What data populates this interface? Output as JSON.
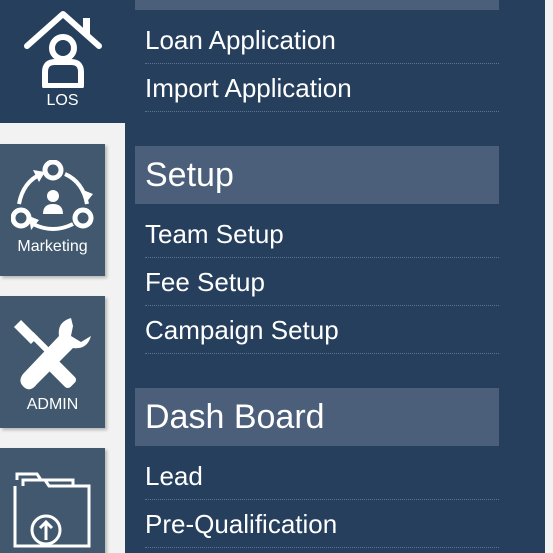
{
  "rail": {
    "items": [
      {
        "label": "LOS",
        "icon": "house-user-icon"
      },
      {
        "label": "Marketing",
        "icon": "people-cycle-icon"
      },
      {
        "label": "ADMIN",
        "icon": "tools-icon"
      },
      {
        "label": "",
        "icon": "folder-upload-icon"
      }
    ]
  },
  "menu": {
    "los_items": [
      {
        "label": "Loan Application"
      },
      {
        "label": "Import Application"
      }
    ],
    "setup": {
      "title": "Setup",
      "items": [
        {
          "label": "Team Setup"
        },
        {
          "label": "Fee Setup"
        },
        {
          "label": "Campaign Setup"
        }
      ]
    },
    "dashboard": {
      "title": "Dash Board",
      "items": [
        {
          "label": "Lead"
        },
        {
          "label": "Pre-Qualification"
        }
      ]
    }
  },
  "colors": {
    "panel": "#263f5d",
    "rail_tile": "#41586f",
    "section_header": "#4b5f7a",
    "background": "#f2f2f2"
  }
}
